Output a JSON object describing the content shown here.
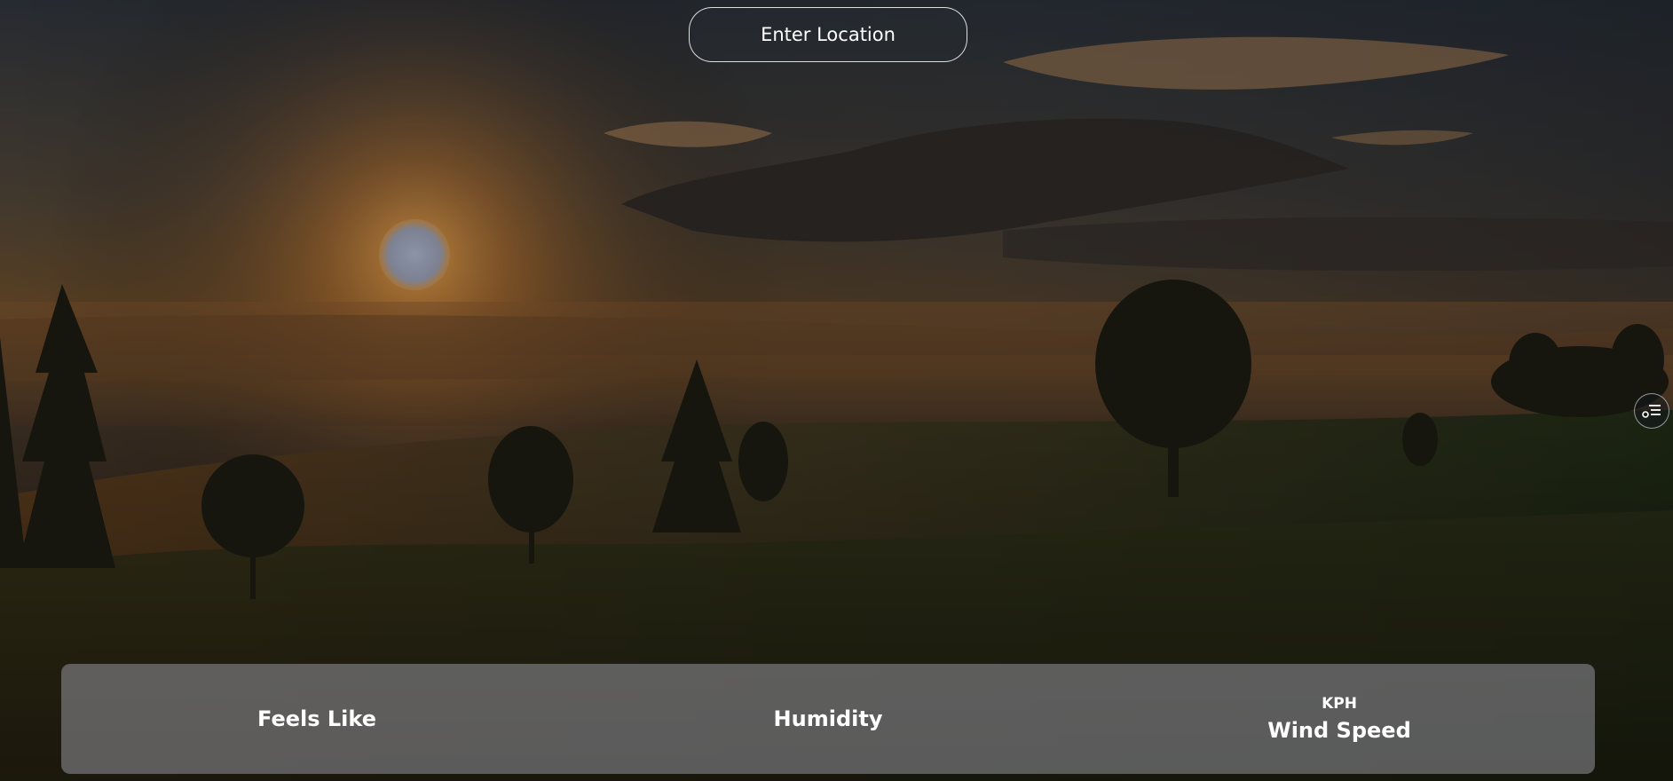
{
  "search": {
    "placeholder": "Enter Location",
    "value": ""
  },
  "side_button": {
    "icon": "settings-list-icon"
  },
  "stats": {
    "feels_like": {
      "value": "",
      "label": "Feels Like"
    },
    "humidity": {
      "value": "",
      "label": "Humidity"
    },
    "wind_speed": {
      "value": "KPH",
      "label": "Wind Speed"
    }
  },
  "colors": {
    "panel": "#94949c",
    "text": "#ffffff"
  }
}
